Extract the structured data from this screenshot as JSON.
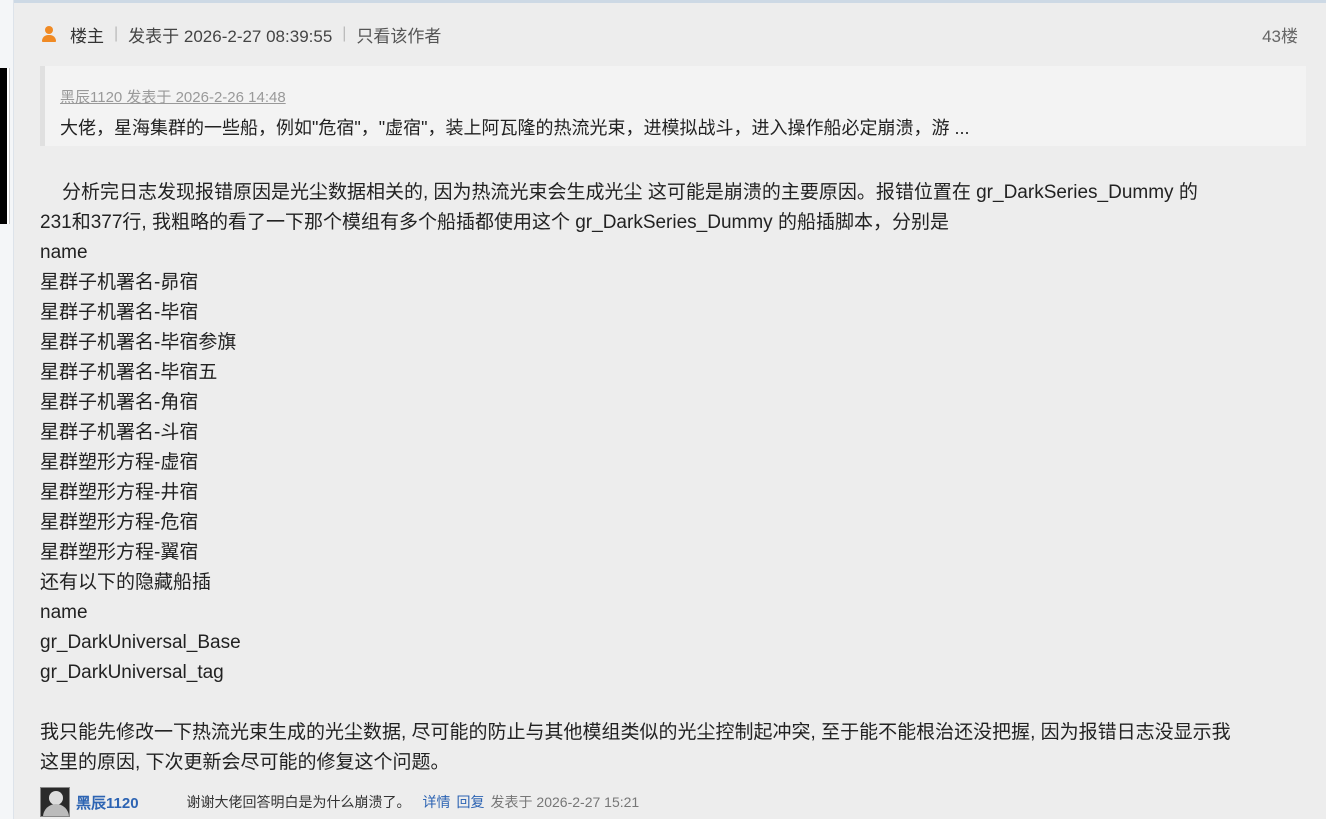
{
  "header": {
    "role": "楼主",
    "posted": "发表于 2026-2-27 08:39:55",
    "only_author": "只看该作者",
    "floor": "43楼"
  },
  "quote": {
    "meta": "黑辰1120 发表于 2026-2-26 14:48",
    "text": "大佬，星海集群的一些船，例如\"危宿\"，\"虚宿\"，装上阿瓦隆的热流光束，进模拟战斗，进入操作船必定崩溃，游 ..."
  },
  "content": {
    "intro_line1": "分析完日志发现报错原因是光尘数据相关的, 因为热流光束会生成光尘 这可能是崩溃的主要原因。报错位置在 gr_DarkSeries_Dummy 的",
    "intro_line2": "231和377行, 我粗略的看了一下那个模组有多个船插都使用这个 gr_DarkSeries_Dummy 的船插脚本，分别是",
    "list1": [
      "name",
      "星群子机署名-昴宿",
      "星群子机署名-毕宿",
      "星群子机署名-毕宿参旗",
      "星群子机署名-毕宿五",
      "星群子机署名-角宿",
      "星群子机署名-斗宿",
      "星群塑形方程-虚宿",
      "星群塑形方程-井宿",
      "星群塑形方程-危宿",
      "星群塑形方程-翼宿"
    ],
    "hidden_title": "还有以下的隐藏船插",
    "list2": [
      "name",
      "gr_DarkUniversal_Base",
      "gr_DarkUniversal_tag"
    ],
    "outro_line1": "我只能先修改一下热流光束生成的光尘数据, 尽可能的防止与其他模组类似的光尘控制起冲突, 至于能不能根治还没把握, 因为报错日志没显示我",
    "outro_line2": "这里的原因, 下次更新会尽可能的修复这个问题。"
  },
  "reply": {
    "user": "黑辰1120",
    "text": "谢谢大佬回答明白是为什么崩溃了。",
    "detail": "详情",
    "reply_link": "回复",
    "time": "发表于 2026-2-27 15:21"
  },
  "colors": {
    "accent_orange": "#f08a24",
    "link_blue": "#2d64b3",
    "background": "#ededed"
  }
}
